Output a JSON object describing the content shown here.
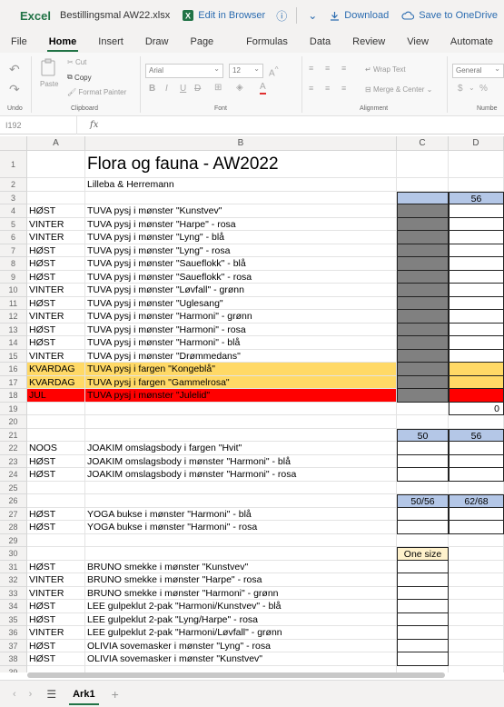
{
  "titlebar": {
    "app": "Excel",
    "filename": "Bestillingsmal AW22.xlsx",
    "edit_in_browser": "Edit in Browser",
    "download": "Download",
    "save_onedrive": "Save to OneDrive"
  },
  "tabs": [
    "File",
    "Home",
    "Insert",
    "Draw",
    "Page Layout",
    "Formulas",
    "Data",
    "Review",
    "View",
    "Automate"
  ],
  "ribbon": {
    "undo": "Undo",
    "paste": "Paste",
    "cut": "Cut",
    "copy": "Copy",
    "format_painter": "Format Painter",
    "clipboard": "Clipboard",
    "font_name": "Arial",
    "font_size": "12",
    "font": "Font",
    "wrap_text": "Wrap Text",
    "merge_center": "Merge & Center",
    "alignment": "Alignment",
    "number_format": "General",
    "currency": "$",
    "percent": "%",
    "number": "Numbe"
  },
  "formula_bar": {
    "name_box": "I192",
    "fx": "fx"
  },
  "columns": [
    "A",
    "B",
    "C",
    "D"
  ],
  "rows": [
    {
      "n": "1",
      "a": "",
      "b": "Flora og fauna - AW2022",
      "c": "",
      "d": ""
    },
    {
      "n": "2",
      "a": "",
      "b": "Lilleba & Herremann",
      "c": "",
      "d": ""
    },
    {
      "n": "3",
      "a": "",
      "b": "",
      "c": "",
      "d": "56"
    },
    {
      "n": "4",
      "a": "HØST",
      "b": "TUVA pysj i mønster \"Kunstvev\"",
      "c": "",
      "d": ""
    },
    {
      "n": "5",
      "a": "VINTER",
      "b": "TUVA pysj i mønster \"Harpe\" - rosa",
      "c": "",
      "d": ""
    },
    {
      "n": "6",
      "a": "VINTER",
      "b": "TUVA pysj i mønster \"Lyng\" - blå",
      "c": "",
      "d": ""
    },
    {
      "n": "7",
      "a": "HØST",
      "b": "TUVA pysj i mønster \"Lyng\" - rosa",
      "c": "",
      "d": ""
    },
    {
      "n": "8",
      "a": "HØST",
      "b": "TUVA pysj i mønster \"Saueflokk\" - blå",
      "c": "",
      "d": ""
    },
    {
      "n": "9",
      "a": "HØST",
      "b": "TUVA pysj i mønster \"Saueflokk\" - rosa",
      "c": "",
      "d": ""
    },
    {
      "n": "10",
      "a": "VINTER",
      "b": "TUVA pysj i mønster \"Løvfall\" - grønn",
      "c": "",
      "d": ""
    },
    {
      "n": "11",
      "a": "HØST",
      "b": "TUVA pysj i mønster \"Uglesang\"",
      "c": "",
      "d": ""
    },
    {
      "n": "12",
      "a": "VINTER",
      "b": "TUVA pysj i mønster \"Harmoni\" - grønn",
      "c": "",
      "d": ""
    },
    {
      "n": "13",
      "a": "HØST",
      "b": "TUVA pysj i mønster \"Harmoni\" - rosa",
      "c": "",
      "d": ""
    },
    {
      "n": "14",
      "a": "HØST",
      "b": "TUVA pysj i mønster \"Harmoni\" - blå",
      "c": "",
      "d": ""
    },
    {
      "n": "15",
      "a": "VINTER",
      "b": "TUVA pysj i mønster \"Drømmedans\"",
      "c": "",
      "d": ""
    },
    {
      "n": "16",
      "a": "KVARDAG",
      "b": "TUVA pysj i fargen \"Kongeblå\"",
      "c": "",
      "d": ""
    },
    {
      "n": "17",
      "a": "KVARDAG",
      "b": "TUVA pysj i fargen \"Gammelrosa\"",
      "c": "",
      "d": ""
    },
    {
      "n": "18",
      "a": "JUL",
      "b": "TUVA pysj i mønster \"Julelid\"",
      "c": "",
      "d": ""
    },
    {
      "n": "19",
      "a": "",
      "b": "",
      "c": "",
      "d": "0"
    },
    {
      "n": "20",
      "a": "",
      "b": "",
      "c": "",
      "d": ""
    },
    {
      "n": "21",
      "a": "",
      "b": "",
      "c": "50",
      "d": "56"
    },
    {
      "n": "22",
      "a": "NOOS",
      "b": "JOAKIM omslagsbody i fargen \"Hvit\"",
      "c": "",
      "d": ""
    },
    {
      "n": "23",
      "a": "HØST",
      "b": "JOAKIM omslagsbody i mønster \"Harmoni\" - blå",
      "c": "",
      "d": ""
    },
    {
      "n": "24",
      "a": "HØST",
      "b": "JOAKIM omslagsbody i mønster \"Harmoni\" - rosa",
      "c": "",
      "d": ""
    },
    {
      "n": "25",
      "a": "",
      "b": "",
      "c": "",
      "d": ""
    },
    {
      "n": "26",
      "a": "",
      "b": "",
      "c": "50/56",
      "d": "62/68"
    },
    {
      "n": "27",
      "a": "HØST",
      "b": "YOGA bukse i mønster \"Harmoni\" - blå",
      "c": "",
      "d": ""
    },
    {
      "n": "28",
      "a": "HØST",
      "b": "YOGA bukse i mønster \"Harmoni\" - rosa",
      "c": "",
      "d": ""
    },
    {
      "n": "29",
      "a": "",
      "b": "",
      "c": "",
      "d": ""
    },
    {
      "n": "30",
      "a": "",
      "b": "",
      "c": "One size",
      "d": ""
    },
    {
      "n": "31",
      "a": "HØST",
      "b": "BRUNO smekke i mønster \"Kunstvev\"",
      "c": "",
      "d": ""
    },
    {
      "n": "32",
      "a": "VINTER",
      "b": "BRUNO smekke i mønster \"Harpe\" - rosa",
      "c": "",
      "d": ""
    },
    {
      "n": "33",
      "a": "VINTER",
      "b": "BRUNO smekke i mønster \"Harmoni\" - grønn",
      "c": "",
      "d": ""
    },
    {
      "n": "34",
      "a": "HØST",
      "b": "LEE gulpeklut 2-pak \"Harmoni/Kunstvev\" - blå",
      "c": "",
      "d": ""
    },
    {
      "n": "35",
      "a": "HØST",
      "b": "LEE gulpeklut 2-pak \"Lyng/Harpe\" - rosa",
      "c": "",
      "d": ""
    },
    {
      "n": "36",
      "a": "VINTER",
      "b": "LEE gulpeklut 2-pak \"Harmoni/Løvfall\" - grønn",
      "c": "",
      "d": ""
    },
    {
      "n": "37",
      "a": "HØST",
      "b": "OLIVIA sovemasker i mønster \"Lyng\" - rosa",
      "c": "",
      "d": ""
    },
    {
      "n": "38",
      "a": "HØST",
      "b": "OLIVIA sovemasker i mønster \"Kunstvev\"",
      "c": "",
      "d": ""
    },
    {
      "n": "39",
      "a": "",
      "b": "",
      "c": "",
      "d": ""
    }
  ],
  "sheetbar": {
    "sheet_name": "Ark1",
    "add": "+"
  },
  "colors": {
    "accent": "#217346",
    "blue_header": "#b4c7e7",
    "gray_cell": "#808080",
    "yellow_row": "#ffd966",
    "red_row": "#ff0000",
    "cream_header": "#fff2cc"
  }
}
